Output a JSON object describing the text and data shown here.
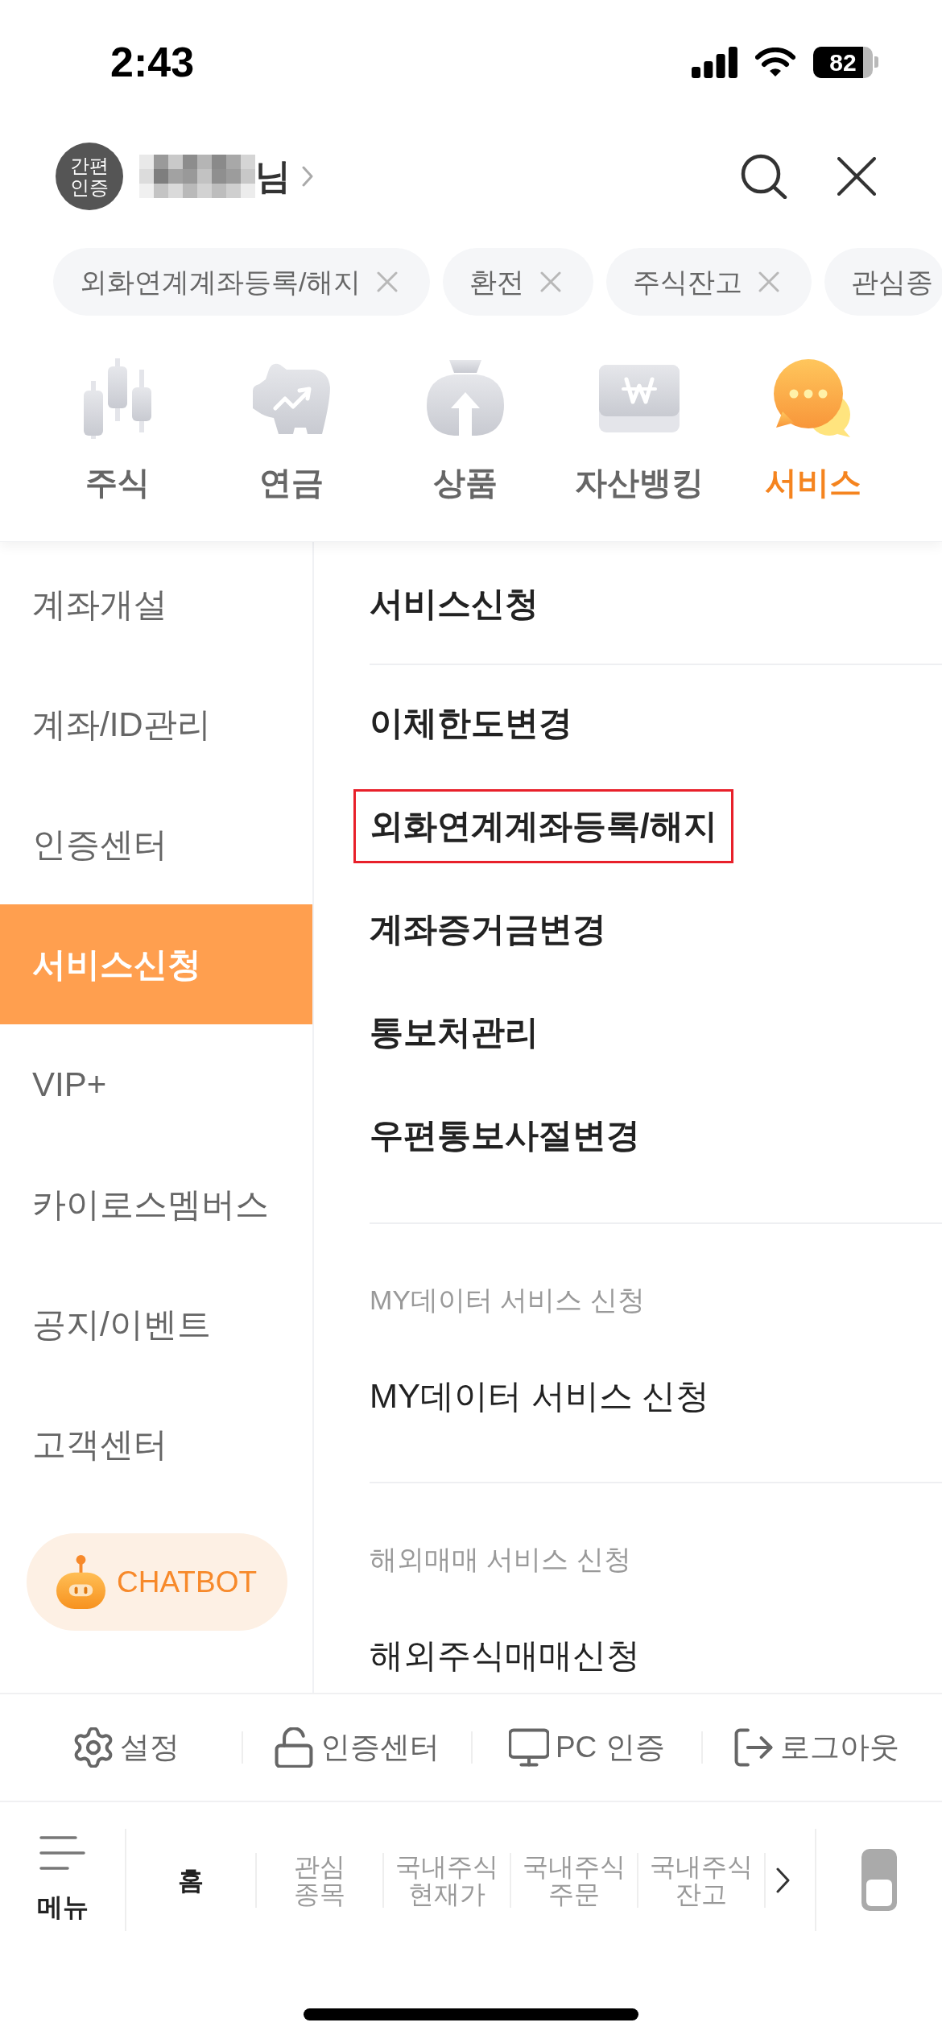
{
  "status_bar": {
    "time": "2:43",
    "battery": "82"
  },
  "header": {
    "badge": "간편 인증",
    "name_suffix": "님"
  },
  "chips": [
    {
      "label": "외화연계계좌등록/해지",
      "closable": true
    },
    {
      "label": "환전",
      "closable": true
    },
    {
      "label": "주식잔고",
      "closable": true
    },
    {
      "label": "관심종",
      "closable": false
    }
  ],
  "categories": [
    {
      "label": "주식",
      "kind": "candles",
      "selected": false
    },
    {
      "label": "연금",
      "kind": "piggy",
      "selected": false
    },
    {
      "label": "상품",
      "kind": "bag",
      "selected": false
    },
    {
      "label": "자산뱅킹",
      "kind": "card",
      "selected": false
    },
    {
      "label": "서비스",
      "kind": "chat",
      "selected": true
    }
  ],
  "sidebar": {
    "items": [
      {
        "label": "계좌개설",
        "selected": false
      },
      {
        "label": "계좌/ID관리",
        "selected": false
      },
      {
        "label": "인증센터",
        "selected": false
      },
      {
        "label": "서비스신청",
        "selected": true
      },
      {
        "label": "VIP+",
        "selected": false
      },
      {
        "label": "카이로스멤버스",
        "selected": false
      },
      {
        "label": "공지/이벤트",
        "selected": false
      },
      {
        "label": "고객센터",
        "selected": false
      }
    ],
    "chatbot": "CHATBOT"
  },
  "menu": {
    "groups": [
      {
        "kind": "primary",
        "title": "서비스신청",
        "items": [
          {
            "label": "이체한도변경",
            "outlined": false
          },
          {
            "label": "외화연계계좌등록/해지",
            "outlined": true
          },
          {
            "label": "계좌증거금변경",
            "outlined": false
          },
          {
            "label": "통보처관리",
            "outlined": false
          },
          {
            "label": "우편통보사절변경",
            "outlined": false
          }
        ]
      },
      {
        "kind": "secondary",
        "title": "MY데이터 서비스 신청",
        "items": [
          {
            "label": "MY데이터 서비스 신청",
            "outlined": false
          }
        ]
      },
      {
        "kind": "secondary",
        "title": "해외매매 서비스 신청",
        "items": [
          {
            "label": "해외주식매매신청",
            "outlined": false
          }
        ]
      }
    ]
  },
  "footer_links": [
    {
      "label": "설정",
      "kind": "settings"
    },
    {
      "label": "인증센터",
      "kind": "lock"
    },
    {
      "label": "PC 인증",
      "kind": "monitor"
    },
    {
      "label": "로그아웃",
      "kind": "logout"
    }
  ],
  "tab_bar": {
    "menu_label": "메뉴",
    "tabs": [
      {
        "label": "홈",
        "selected": true
      },
      {
        "label": "관심 종목",
        "selected": false
      },
      {
        "label": "국내주식 현재가",
        "selected": false
      },
      {
        "label": "국내주식 주문",
        "selected": false
      },
      {
        "label": "국내주식 잔고",
        "selected": false
      }
    ]
  }
}
